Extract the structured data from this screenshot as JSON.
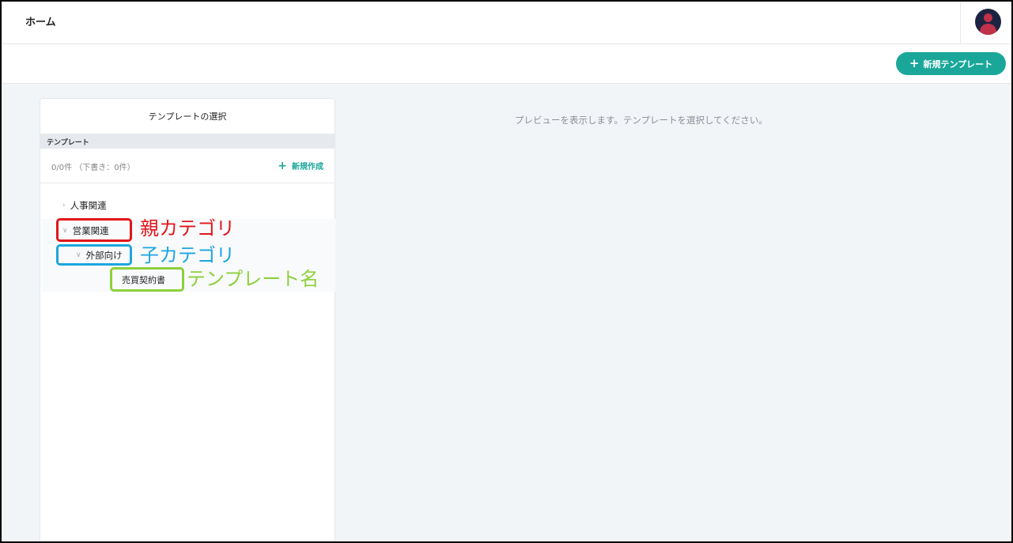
{
  "header": {
    "title": "ホーム"
  },
  "toolbar": {
    "new_template_label": "新規テンプレート"
  },
  "panel": {
    "title": "テンプレートの選択",
    "section_label": "テンプレート",
    "count": "0/0件 （下書き：0件）",
    "create_label": "新規作成",
    "tree": {
      "hr": "人事関連",
      "sales": "営業関連",
      "external": "外部向け",
      "template": "売買契約書"
    }
  },
  "annotations": {
    "parent_category": "親カテゴリ",
    "child_category": "子カテゴリ",
    "template_name": "テンプレート名"
  },
  "preview": {
    "message": "プレビューを表示します。テンプレートを選択してください。"
  },
  "colors": {
    "accent": "#1aa79a",
    "annotation_red": "#e0161c",
    "annotation_blue": "#1ca6e0",
    "annotation_green": "#8dd03c"
  }
}
